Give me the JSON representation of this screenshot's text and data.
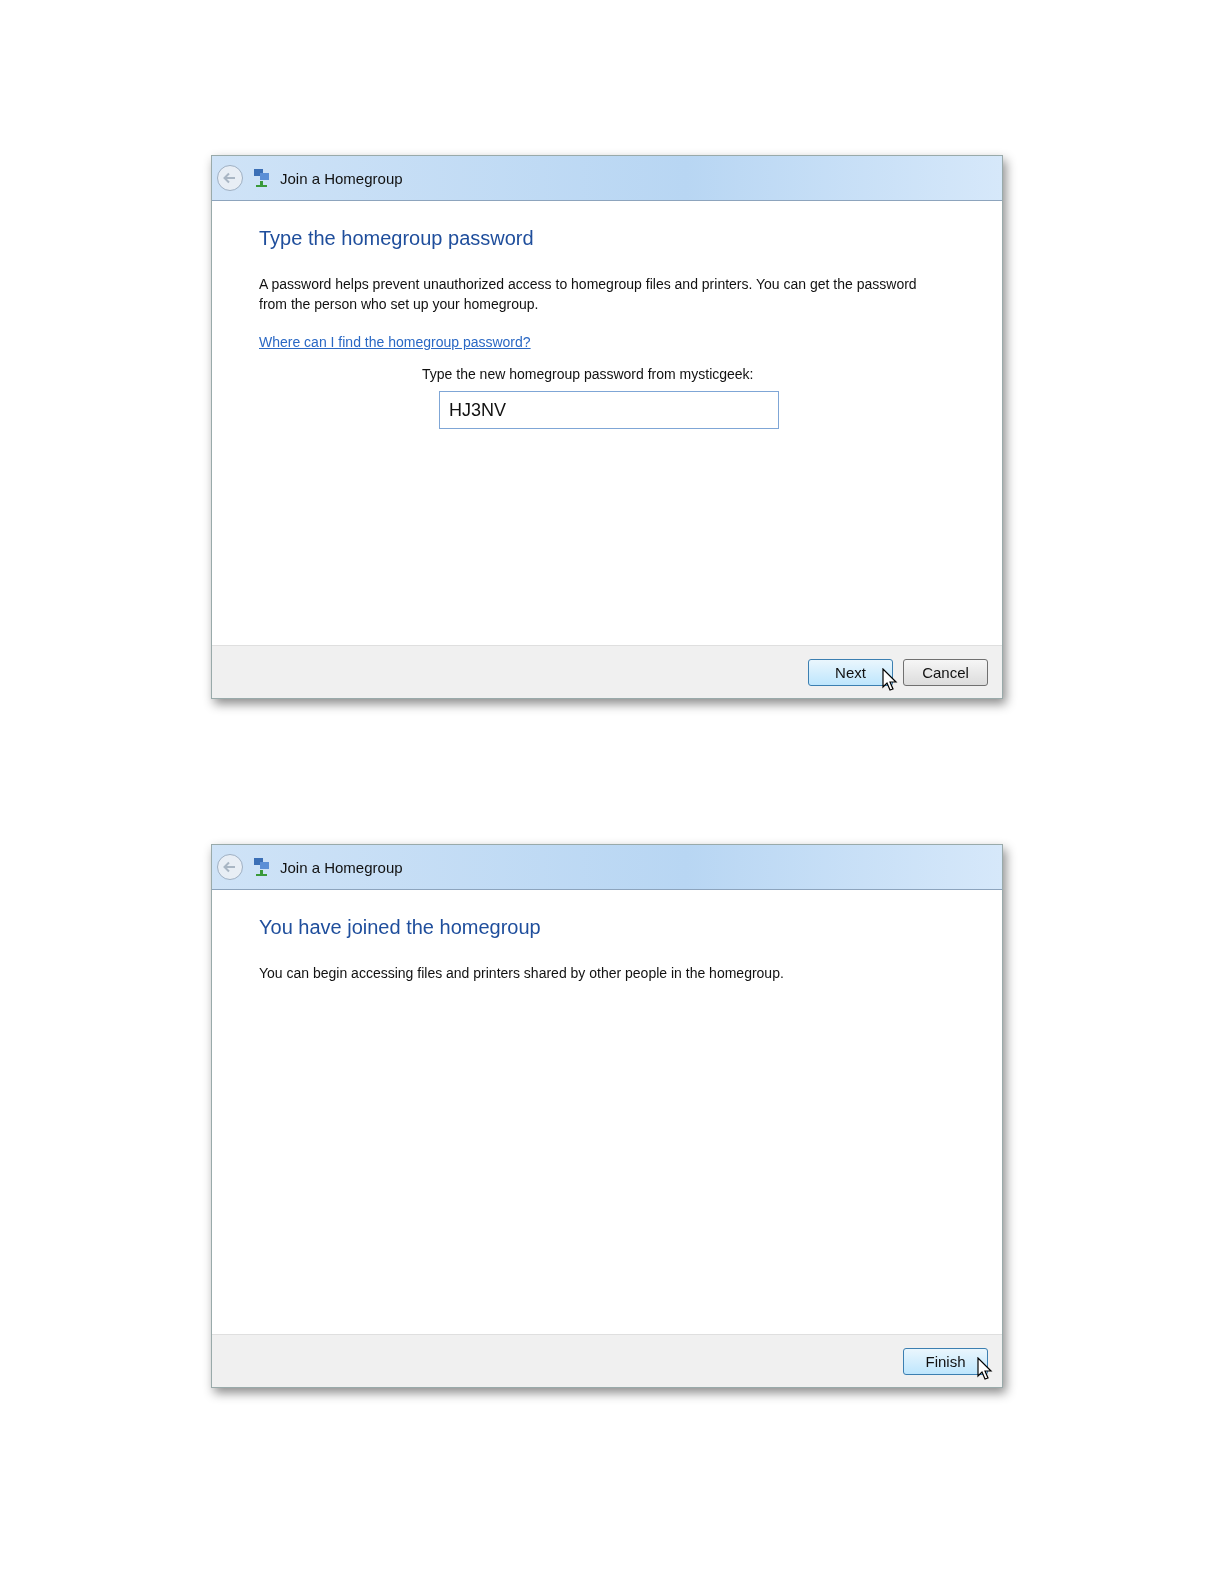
{
  "dialogs": [
    {
      "title": "Join a Homegroup",
      "heading": "Type the homegroup password",
      "text": "A password helps prevent unauthorized access to homegroup files and printers. You can get the password from the person who set up your homegroup.",
      "link": "Where can I find the homegroup password?",
      "field": {
        "label": "Type the new homegroup password from mysticgeek:",
        "value": "HJ3NV"
      },
      "buttons": [
        {
          "label": "Next",
          "hovered": true
        },
        {
          "label": "Cancel",
          "hovered": false
        }
      ]
    },
    {
      "title": "Join a Homegroup",
      "heading": "You have joined the homegroup",
      "text": "You can begin accessing files and printers shared by other people in the homegroup.",
      "buttons": [
        {
          "label": "Finish",
          "hovered": true
        }
      ]
    }
  ]
}
